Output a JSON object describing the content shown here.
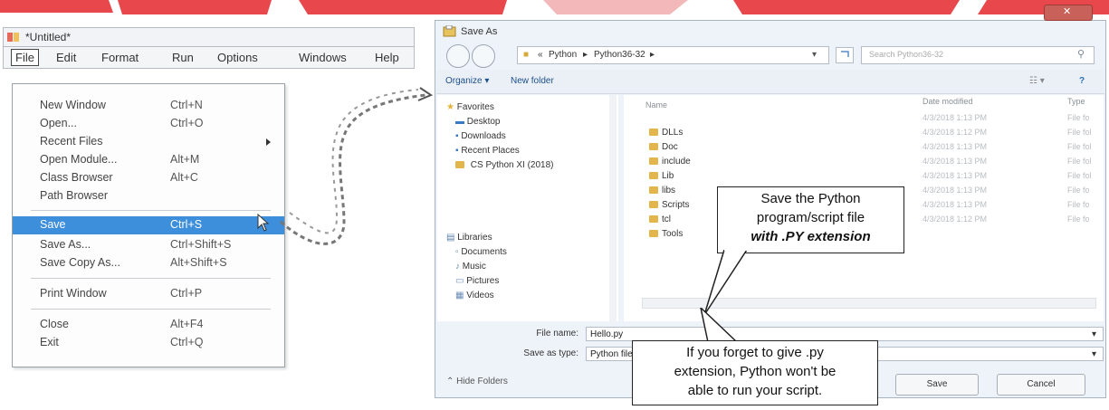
{
  "idle": {
    "title": "*Untitled*",
    "menus": [
      "File",
      "Edit",
      "Format",
      "Run",
      "Options",
      "Windows",
      "Help"
    ],
    "file_menu": [
      {
        "label": "New Window",
        "shortcut": "Ctrl+N"
      },
      {
        "label": "Open...",
        "shortcut": "Ctrl+O"
      },
      {
        "label": "Recent Files",
        "shortcut": ""
      },
      {
        "label": "Open Module...",
        "shortcut": "Alt+M"
      },
      {
        "label": "Class Browser",
        "shortcut": "Alt+C"
      },
      {
        "label": "Path Browser",
        "shortcut": ""
      },
      {
        "label": "Save",
        "shortcut": "Ctrl+S"
      },
      {
        "label": "Save As...",
        "shortcut": "Ctrl+Shift+S"
      },
      {
        "label": "Save Copy As...",
        "shortcut": "Alt+Shift+S"
      },
      {
        "label": "Print Window",
        "shortcut": "Ctrl+P"
      },
      {
        "label": "Close",
        "shortcut": "Alt+F4"
      },
      {
        "label": "Exit",
        "shortcut": "Ctrl+Q"
      }
    ]
  },
  "dialog": {
    "title": "Save As",
    "breadcrumb": [
      "«",
      "Python",
      "▸",
      "Python36-32",
      "▸"
    ],
    "search_placeholder": "Search Python36-32",
    "organize": "Organize ▾",
    "new_folder": "New folder",
    "nav": {
      "favorites": "Favorites",
      "favorite_items": [
        "Desktop",
        "Downloads",
        "Recent Places",
        "CS Python XI (2018)"
      ],
      "libraries": "Libraries",
      "library_items": [
        "Documents",
        "Music",
        "Pictures",
        "Videos"
      ]
    },
    "columns": {
      "name": "Name",
      "date": "Date modified",
      "type": "Type"
    },
    "files": [
      "DLLs",
      "Doc",
      "include",
      "Lib",
      "libs",
      "Scripts",
      "tcl",
      "Tools"
    ],
    "dates": [
      "4/3/2018 1:13 PM",
      "4/3/2018 1:12 PM",
      "4/3/2018 1:13 PM",
      "4/3/2018 1:13 PM",
      "4/3/2018 1:13 PM",
      "4/3/2018 1:13 PM",
      "4/3/2018 1:13 PM",
      "4/3/2018 1:12 PM"
    ],
    "types": [
      "File fo",
      "File fol",
      "File fol",
      "File fol",
      "File fol",
      "File fo",
      "File fo",
      "File fo"
    ],
    "file_name_label": "File name:",
    "file_name_value": "Hello.py",
    "save_type_label": "Save as type:",
    "save_type_value": "Python files",
    "hide_folders": "Hide Folders",
    "save_button": "Save",
    "cancel_button": "Cancel"
  },
  "callouts": {
    "top": [
      "Save the Python",
      "program/script file",
      "with .PY extension"
    ],
    "bottom": [
      "If you forget to give .py",
      "extension, Python won't be",
      "able to run your script."
    ]
  },
  "colors": {
    "highlight": "#3d8edb",
    "banner": "#e0383e"
  }
}
